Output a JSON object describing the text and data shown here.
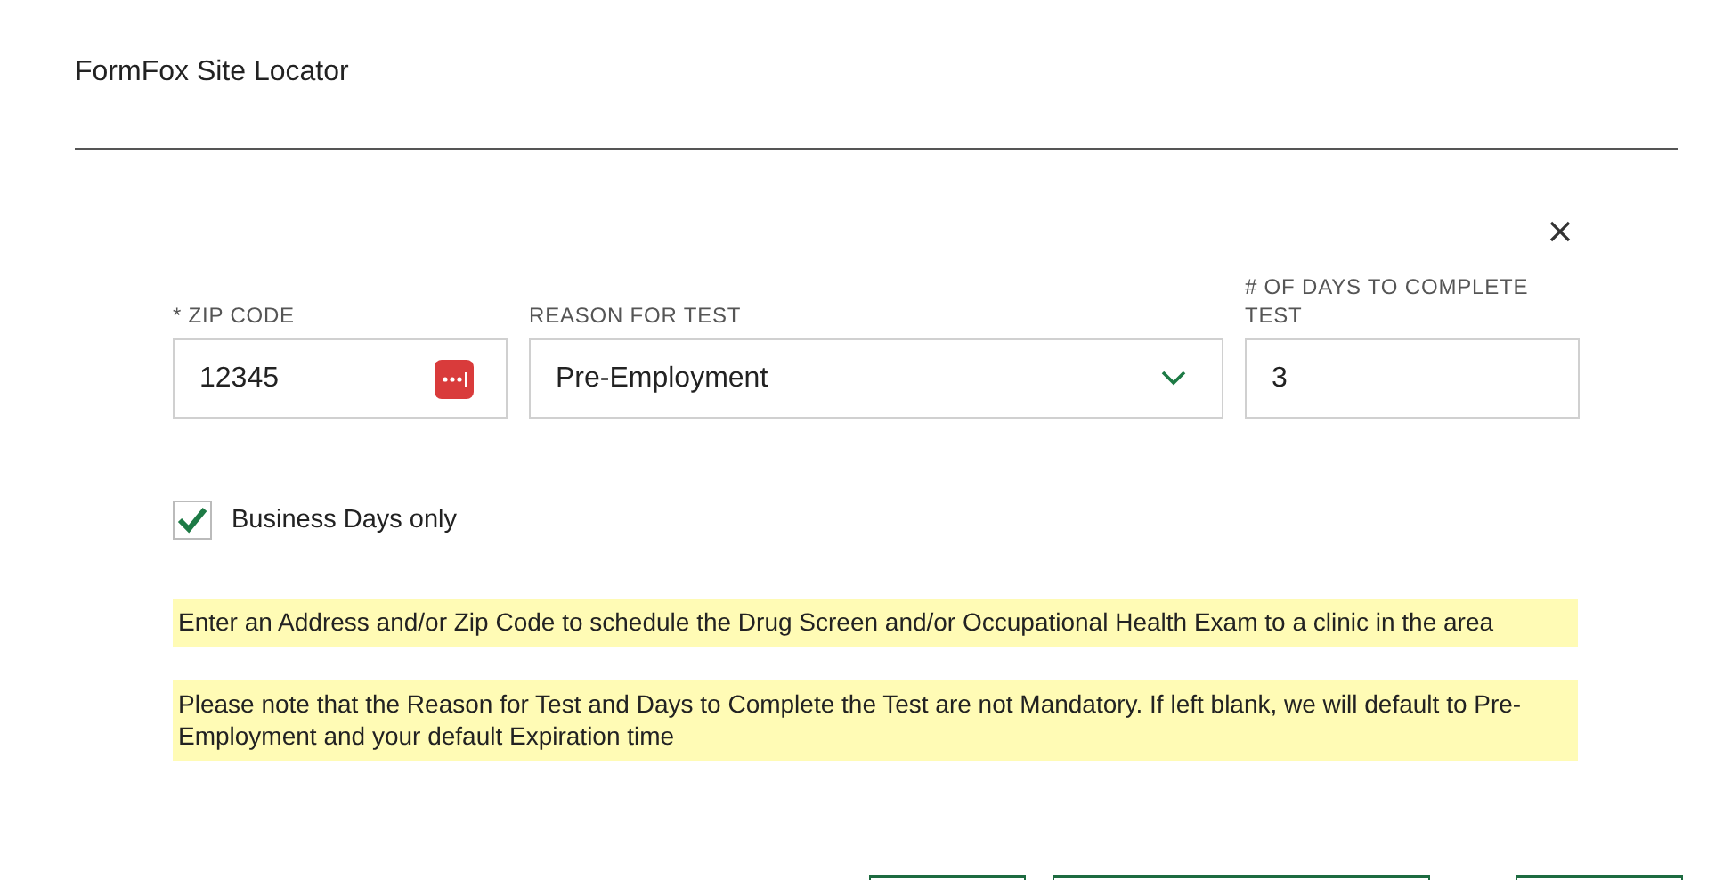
{
  "window": {
    "title": "FormFox Site Locator"
  },
  "fields": [
    {
      "kind": "text",
      "label": "* ZIP CODE",
      "value": "12345"
    },
    {
      "kind": "select",
      "label": "REASON FOR TEST",
      "value": "Pre-Employment"
    },
    {
      "kind": "text",
      "label": "# OF DAYS TO COMPLETE TEST",
      "value": "3"
    }
  ],
  "business_days": {
    "label": "Business Days only",
    "checked": true
  },
  "notes": [
    "Enter an Address and/or Zip Code to schedule the Drug Screen and/or Occupational Health Exam to a clinic in the area",
    "Please note that the Reason for Test and Days to Complete the Test are not Mandatory. If left blank, we will default to Pre-Employment and your default Expiration time"
  ],
  "buttons": [
    {
      "kind": "outline"
    },
    {
      "kind": "outline"
    },
    {
      "kind": "outline"
    }
  ]
}
